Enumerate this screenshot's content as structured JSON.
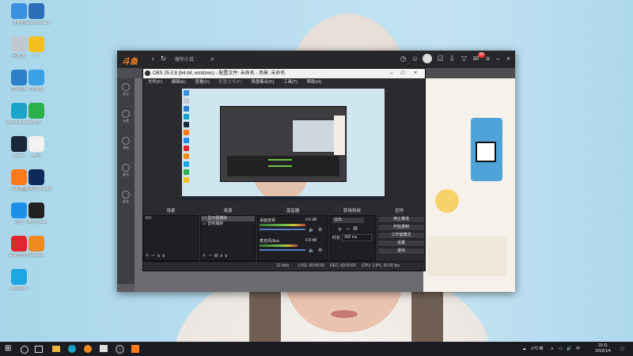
{
  "desktop_icons": [
    {
      "label": "此电脑",
      "color": "#3a8fe0"
    },
    {
      "label": "SteamSpeak 3",
      "color": "#2a6fb8"
    },
    {
      "label": "回收站",
      "color": "#c0c8d0"
    },
    {
      "label": "YY",
      "color": "#f4c01e"
    },
    {
      "label": "控制面板",
      "color": "#2d7fc9"
    },
    {
      "label": "QQ游戏",
      "color": "#3aa0e8"
    },
    {
      "label": "Microsoft Edge",
      "color": "#1aa3c8"
    },
    {
      "label": "微信",
      "color": "#2bb14a"
    },
    {
      "label": "Steam",
      "color": "#1b2838"
    },
    {
      "label": "腾讯",
      "color": "#f2f2f2"
    },
    {
      "label": "斗鱼直播",
      "color": "#ff7a1a"
    },
    {
      "label": "英雄联盟WeGame",
      "color": "#0e2a5a"
    },
    {
      "label": "迅雷",
      "color": "#1c8fe8"
    },
    {
      "label": "OBS Studio",
      "color": "#222222"
    },
    {
      "label": "网易云音乐",
      "color": "#e0262e"
    },
    {
      "label": "Edgeerl",
      "color": "#f08a1e"
    },
    {
      "label": "腾讯视频",
      "color": "#1ea6e0"
    }
  ],
  "browser": {
    "logo": "斗鱼",
    "address": "搜你小说",
    "badge": "99",
    "sidebar": [
      "关注",
      "分类",
      "游戏",
      "娱乐",
      "更多"
    ]
  },
  "obs": {
    "title": "OBS 25.0.8 (64-bit, windows) - 配置文件: 未命名 - 场景: 未命名",
    "menu": [
      "文件(F)",
      "编辑(E)",
      "查看(V)",
      "配置文件(P)",
      "场景集合(S)",
      "工具(T)",
      "帮助(H)"
    ],
    "docks": {
      "scenes": "场景",
      "sources": "来源",
      "mixer": "混音器",
      "transitions": "转场特效",
      "controls": "控件"
    },
    "scenes_list": [
      "0.0"
    ],
    "sources_list": [
      "显示器捕获",
      "音频捕获"
    ],
    "mixer_channels": [
      {
        "name": "桌面音频",
        "db": "0.0 dB",
        "level": 0.72
      },
      {
        "name": "麦克风/Aux",
        "db": "0.0 dB",
        "level": 0.6
      }
    ],
    "transition": {
      "type": "淡出",
      "duration_label": "时长",
      "duration": "300 ms"
    },
    "controls": [
      "停止推流",
      "开始录制",
      "工作室模式",
      "设置",
      "退出"
    ],
    "status": {
      "live": "LIVE: 00:00:00",
      "rec": "REC: 00:00:00",
      "cpu": "CPU: 1.9%, 30.00 fps",
      "kbps": "12 kb/s"
    }
  },
  "taskbar": {
    "weather": "-1°C 晴",
    "ime": "中",
    "time": "20:11",
    "date": "2022/1/4"
  }
}
